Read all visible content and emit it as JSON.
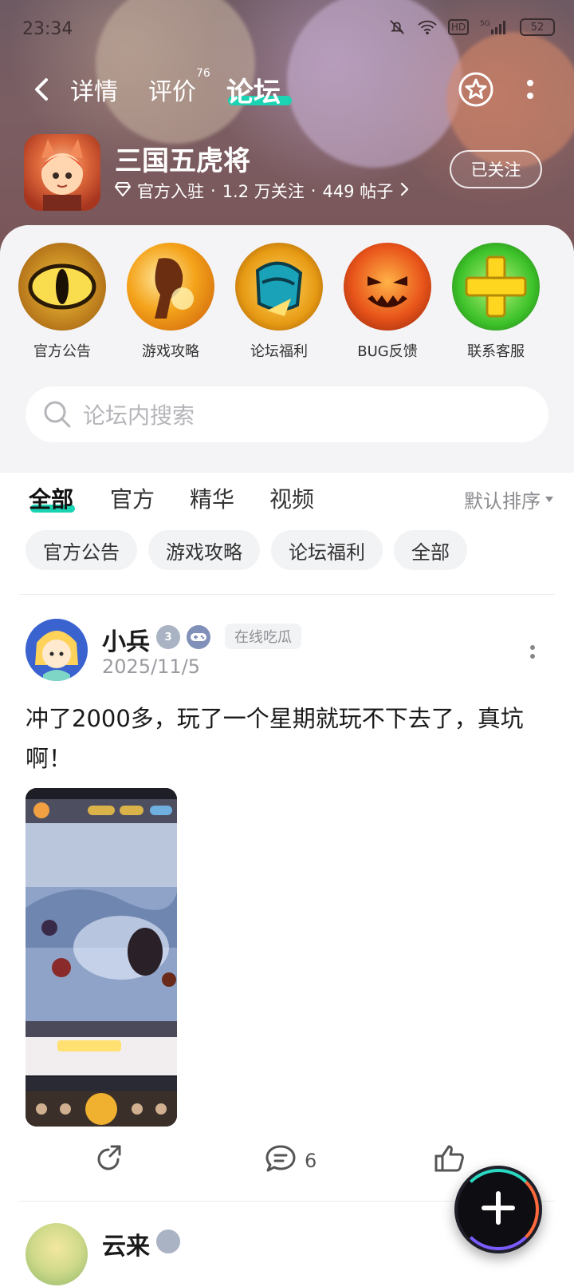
{
  "status_bar": {
    "time": "23:34",
    "network": "5G",
    "hd": "HD",
    "battery": "52"
  },
  "nav": {
    "tabs": [
      {
        "label": "详情"
      },
      {
        "label": "评价",
        "count": "76"
      },
      {
        "label": "论坛"
      }
    ],
    "active_tab": "论坛"
  },
  "game": {
    "title": "三国五虎将",
    "official": "官方入驻",
    "followers": "1.2 万关注",
    "posts": "449 帖子",
    "follow_label": "已关注"
  },
  "shortcuts": [
    {
      "label": "官方公告",
      "icon": "eye-icon"
    },
    {
      "label": "游戏攻略",
      "icon": "guide-icon"
    },
    {
      "label": "论坛福利",
      "icon": "gift-icon"
    },
    {
      "label": "BUG反馈",
      "icon": "bug-icon"
    },
    {
      "label": "联系客服",
      "icon": "plus-icon"
    }
  ],
  "search": {
    "placeholder": "论坛内搜索"
  },
  "feed_tabs": [
    {
      "label": "全部"
    },
    {
      "label": "官方"
    },
    {
      "label": "精华"
    },
    {
      "label": "视频"
    }
  ],
  "sort_label": "默认排序",
  "chips": [
    "官方公告",
    "游戏攻略",
    "论坛福利",
    "全部"
  ],
  "post": {
    "author": "小兵",
    "level_badge": "3",
    "tag": "在线吃瓜",
    "date": "2025/11/5",
    "text": "冲了2000多，玩了一个星期就玩不下去了，真坑啊！",
    "comment_count": "6"
  },
  "next_post": {
    "author": "云来"
  },
  "colors": {
    "accent": "#19d3b3",
    "hero_bg": "#7b5e62"
  }
}
